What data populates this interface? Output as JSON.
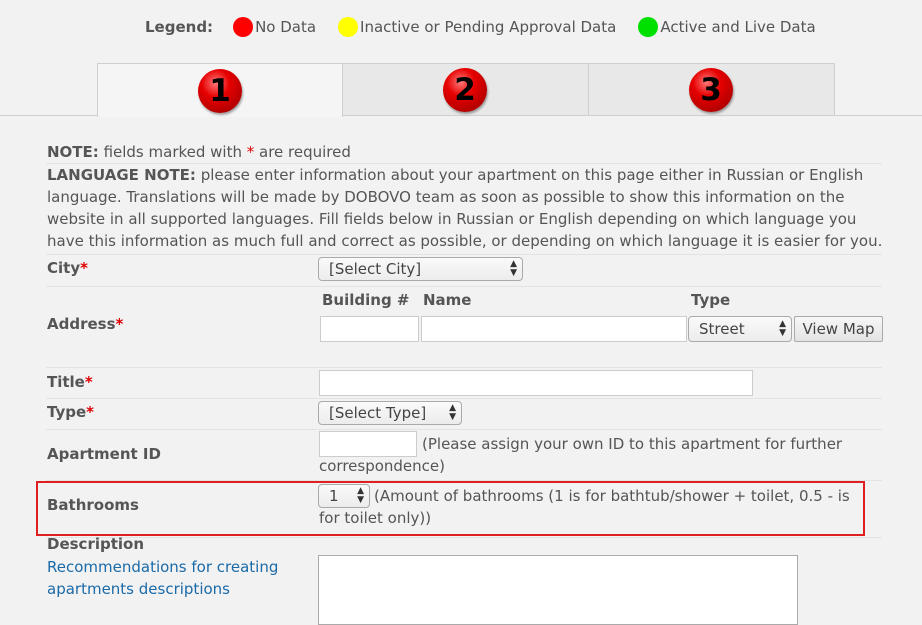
{
  "legend": {
    "label": "Legend:",
    "items": [
      {
        "color": "#ff0000",
        "text": "No Data"
      },
      {
        "color": "#ffff00",
        "text": "Inactive or Pending Approval Data"
      },
      {
        "color": "#00e000",
        "text": "Active and Live Data"
      }
    ]
  },
  "tabs": [
    {
      "number": "1",
      "active": true
    },
    {
      "number": "2",
      "active": false
    },
    {
      "number": "3",
      "active": false
    }
  ],
  "note": {
    "bold": "NOTE:",
    "text": " fields marked with ",
    "star": "*",
    "text2": " are required"
  },
  "lang_note": {
    "bold": "LANGUAGE NOTE:",
    "text": " please enter information about your apartment on this page either in Russian or English language. Translations will be made by DOBOVO team as soon as possible to show this information on the website in all supported languages. Fill fields below in Russian or English depending on which language you have this information as much full and correct as possible, or depending on which language it is easier for you."
  },
  "form": {
    "required_mark": "*",
    "city": {
      "label": "City",
      "value": "[Select City]"
    },
    "address": {
      "label": "Address",
      "building_header": "Building #",
      "name_header": "Name",
      "type_header": "Type",
      "type_value": "Street",
      "view_map": "View Map"
    },
    "title": {
      "label": "Title"
    },
    "type": {
      "label": "Type",
      "value": "[Select Type]"
    },
    "apartment_id": {
      "label": "Apartment ID",
      "hint": "(Please assign your own ID to this apartment for further correspondence)"
    },
    "bathrooms": {
      "label": "Bathrooms",
      "value": "1",
      "hint": "(Amount of bathrooms (1 is for bathtub/shower + toilet, 0.5 - is for toilet only))"
    },
    "description": {
      "label": "Description",
      "link": "Recommendations for creating apartments descriptions"
    }
  },
  "colors": {
    "required": "#dd0000",
    "highlight": "#e02020",
    "link": "#1a6aa8"
  }
}
